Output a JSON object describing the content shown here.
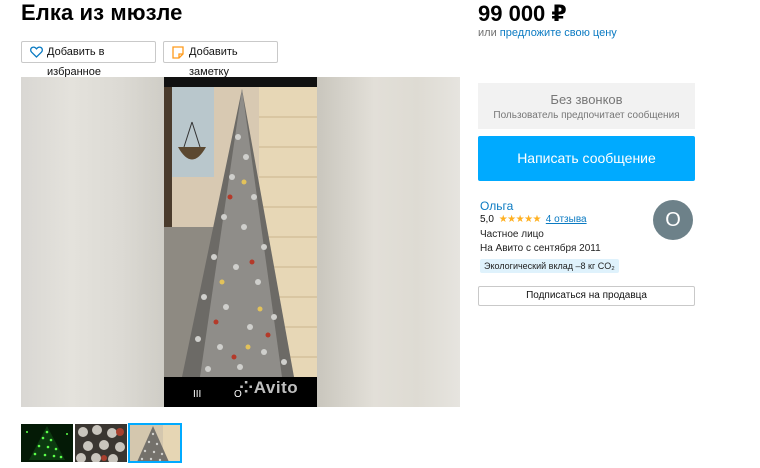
{
  "listing": {
    "title": "Елка из мюзле",
    "price": "99 000 ₽",
    "price_or": "или",
    "price_offer_link": "предложите свою цену"
  },
  "actions": {
    "favorite_label": "Добавить в избранное",
    "note_label": "Добавить заметку"
  },
  "gallery": {
    "watermark": "Avito",
    "nav_recent": "III",
    "nav_home": "O",
    "thumbnails": [
      {
        "icon": "green-lights-tree-thumb",
        "active": false
      },
      {
        "icon": "muselet-caps-thumb",
        "active": false
      },
      {
        "icon": "muselet-tree-thumb",
        "active": true
      }
    ]
  },
  "contact": {
    "no_calls_title": "Без звонков",
    "no_calls_sub": "Пользователь предпочитает сообщения",
    "message_button": "Написать сообщение"
  },
  "seller": {
    "name": "Ольга",
    "rating": "5,0",
    "stars": "★★★★★",
    "reviews": "4 отзыва",
    "type": "Частное лицо",
    "since": "На Авито с сентября 2011",
    "eco": "Экологический вклад –8 кг CO₂",
    "avatar_letter": "О",
    "subscribe_button": "Подписаться на продавца"
  },
  "colors": {
    "accent": "#00aaff",
    "link": "#0a7ac2",
    "star": "#ffb021",
    "avatar_bg": "#6d8189"
  }
}
